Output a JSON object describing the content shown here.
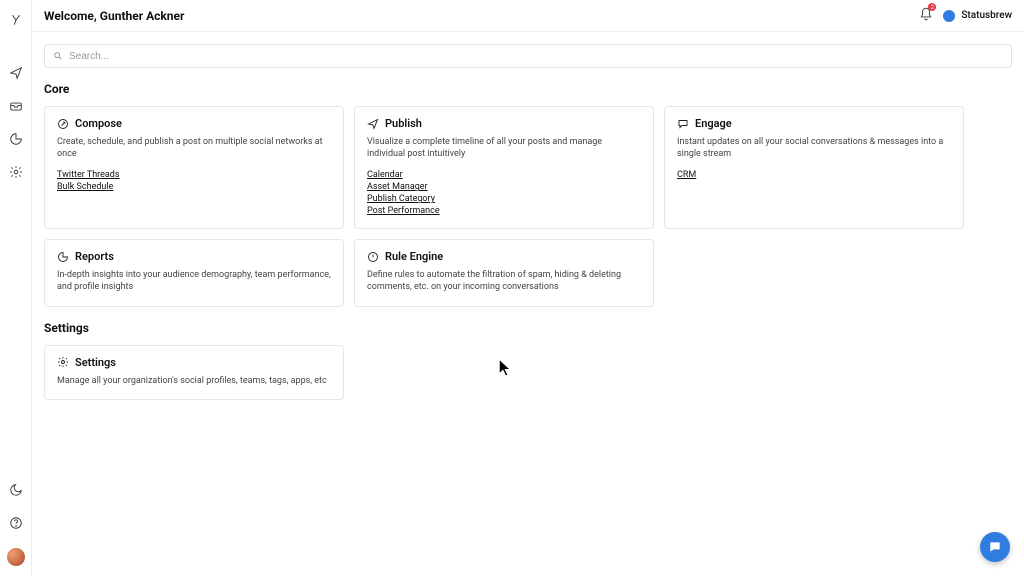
{
  "header": {
    "welcome": "Welcome, Gunther Ackner",
    "notif_count": "2",
    "org_name": "Statusbrew"
  },
  "search": {
    "placeholder": "Search..."
  },
  "sections": {
    "core_title": "Core",
    "settings_title": "Settings"
  },
  "cards": {
    "compose": {
      "title": "Compose",
      "desc": "Create, schedule, and publish a post on multiple social networks at once",
      "link1": "Twitter Threads",
      "link2": "Bulk Schedule"
    },
    "publish": {
      "title": "Publish",
      "desc": "Visualize a complete timeline of all your posts and manage individual post intuitively",
      "link1": "Calendar",
      "link2": "Asset Manager",
      "link3": "Publish Category",
      "link4": "Post Performance"
    },
    "engage": {
      "title": "Engage",
      "desc": "Instant updates on all your social conversations & messages into a single stream",
      "link1": "CRM"
    },
    "reports": {
      "title": "Reports",
      "desc": "In-depth insights into your audience demography, team performance, and profile insights"
    },
    "rule": {
      "title": "Rule Engine",
      "desc": "Define rules to automate the filtration of spam, hiding & deleting comments, etc. on your incoming conversations"
    },
    "settings": {
      "title": "Settings",
      "desc": "Manage all your organization's social profiles, teams, tags, apps, etc"
    }
  }
}
